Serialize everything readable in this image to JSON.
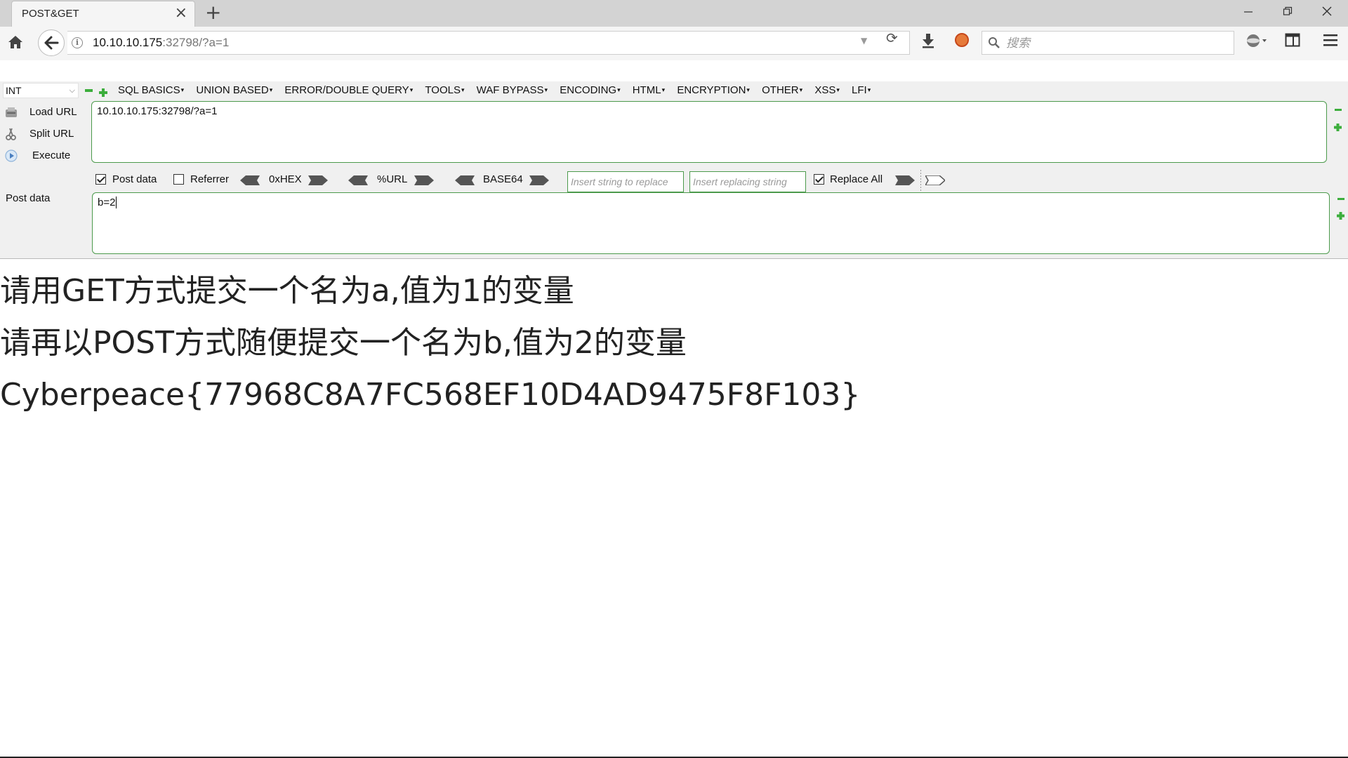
{
  "browser": {
    "tab_title": "POST&GET",
    "url_host": "10.10.10.175",
    "url_rest": ":32798/?a=1",
    "search_placeholder": "搜索"
  },
  "hackbar": {
    "type_select": "INT",
    "menu": [
      "SQL BASICS",
      "UNION BASED",
      "ERROR/DOUBLE QUERY",
      "TOOLS",
      "WAF BYPASS",
      "ENCODING",
      "HTML",
      "ENCRYPTION",
      "OTHER",
      "XSS",
      "LFI"
    ],
    "load_url": "Load URL",
    "split_url": "Split URL",
    "execute": "Execute",
    "url_value": "10.10.10.175:32798/?a=1",
    "post_data_checkbox": "Post data",
    "referrer_checkbox": "Referrer",
    "hex_label": "0xHEX",
    "url_encode_label": "%URL",
    "base64_label": "BASE64",
    "replace_from_placeholder": "Insert string to replace",
    "replace_to_placeholder": "Insert replacing string",
    "replace_all_label": "Replace All",
    "post_data_label": "Post data",
    "post_data_value": "b=2"
  },
  "page": {
    "lines": [
      "请用GET方式提交一个名为a,值为1的变量",
      "请再以POST方式随便提交一个名为b,值为2的变量",
      "Cyberpeace{77968C8A7FC568EF10D4AD9475F8F103}"
    ]
  },
  "colors": {
    "accent_green": "#4c9a4c",
    "tab_strip": "#d3d3d3",
    "toolbar": "#f5f5f5"
  }
}
